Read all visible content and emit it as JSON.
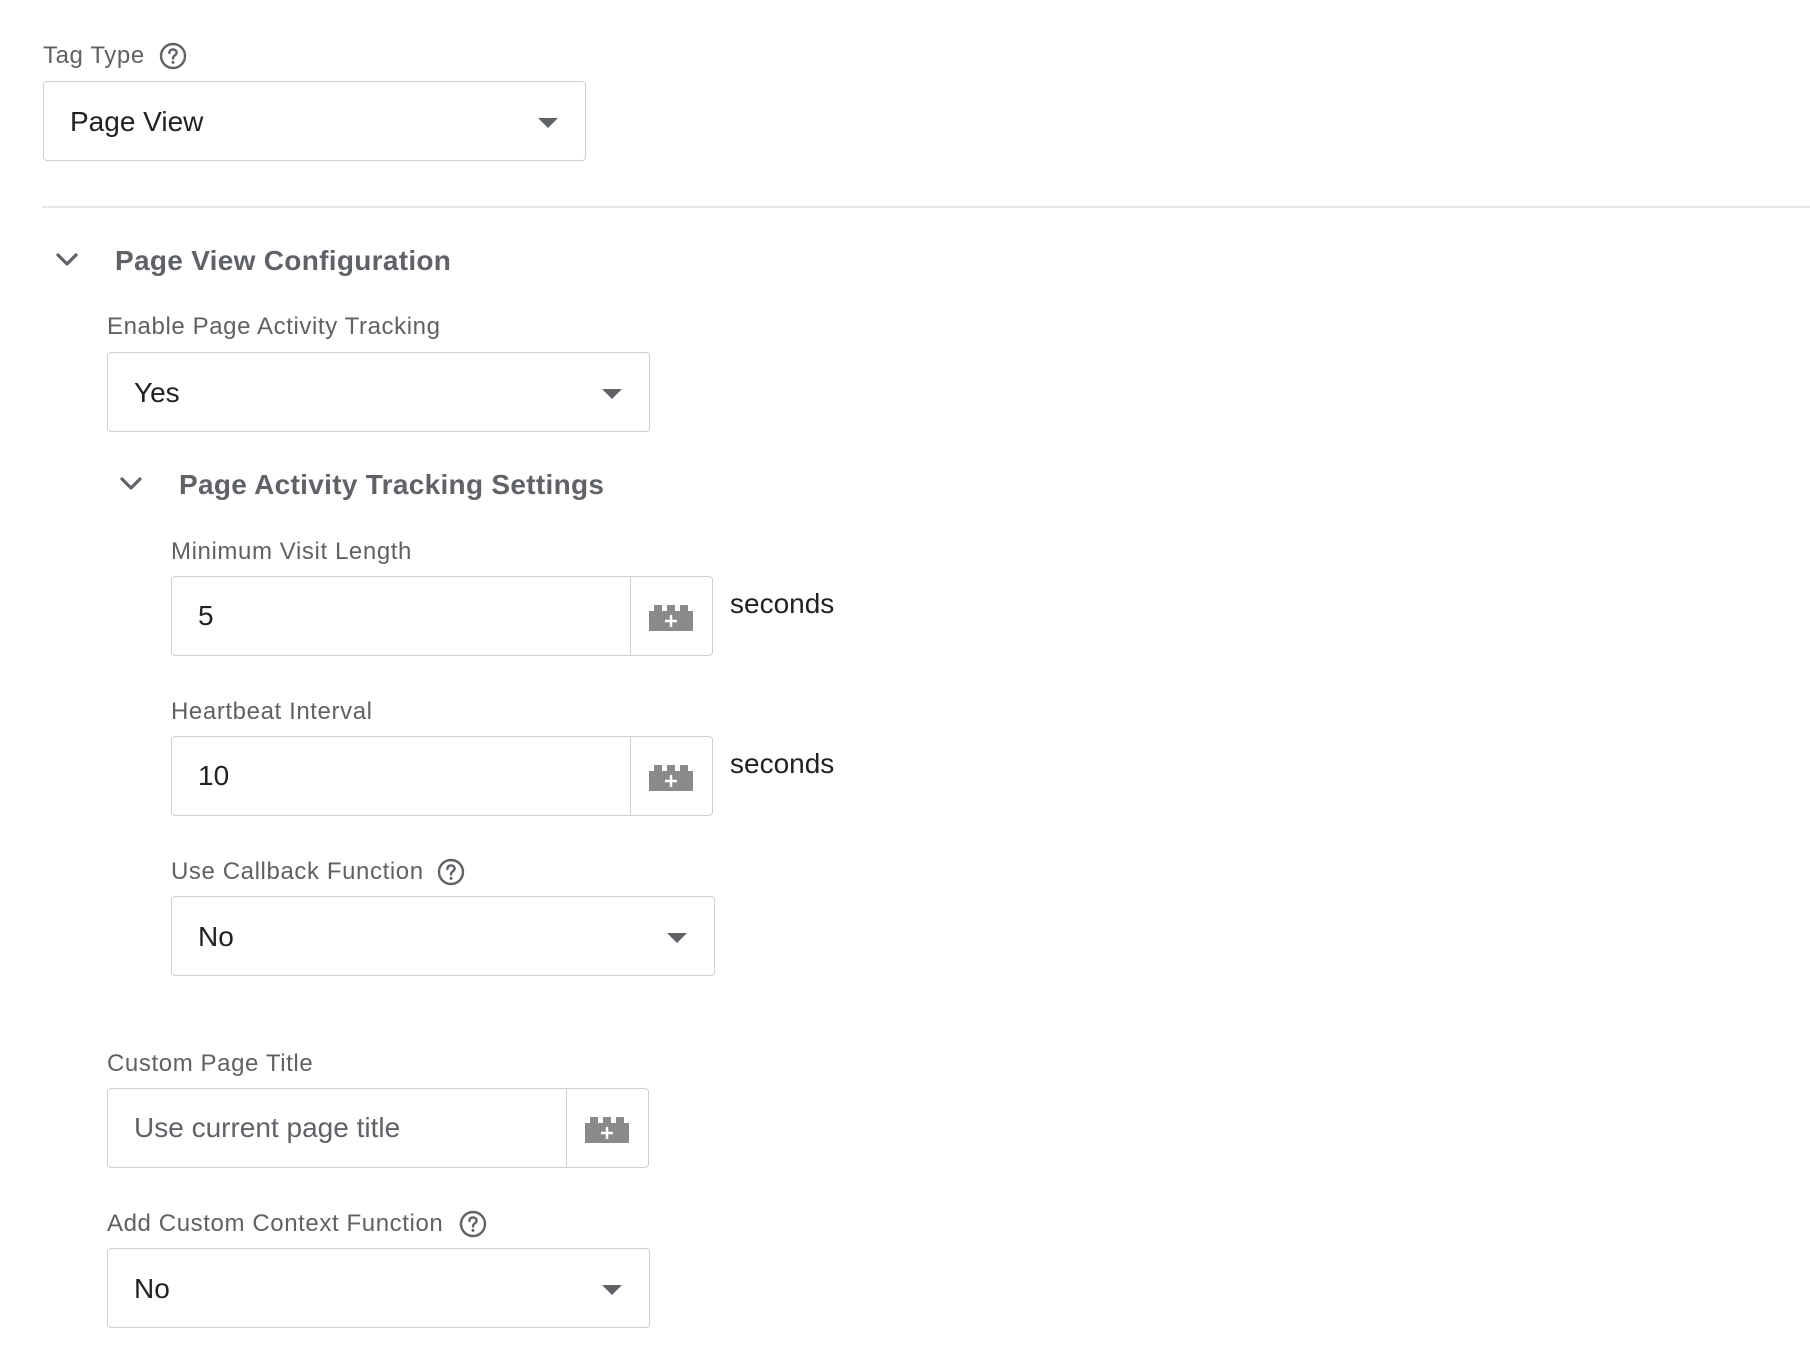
{
  "tag_type": {
    "label": "Tag Type",
    "value": "Page View"
  },
  "page_view_config": {
    "title": "Page View Configuration",
    "enable_tracking": {
      "label": "Enable Page Activity Tracking",
      "value": "Yes"
    },
    "tracking_settings": {
      "title": "Page Activity Tracking Settings",
      "min_visit_length": {
        "label": "Minimum Visit Length",
        "value": "5",
        "suffix": "seconds"
      },
      "heartbeat_interval": {
        "label": "Heartbeat Interval",
        "value": "10",
        "suffix": "seconds"
      },
      "use_callback": {
        "label": "Use Callback Function",
        "value": "No"
      }
    },
    "custom_page_title": {
      "label": "Custom Page Title",
      "placeholder": "Use current page title",
      "value": ""
    },
    "custom_context": {
      "label": "Add Custom Context Function",
      "value": "No"
    }
  },
  "icons": {
    "help": "help-circle-icon",
    "variable": "variable-brick-icon",
    "caret": "caret-down-icon",
    "chevron": "chevron-down-icon"
  },
  "colors": {
    "label": "#616161",
    "border": "#cfcfcf",
    "icon": "#8a8a8a"
  }
}
